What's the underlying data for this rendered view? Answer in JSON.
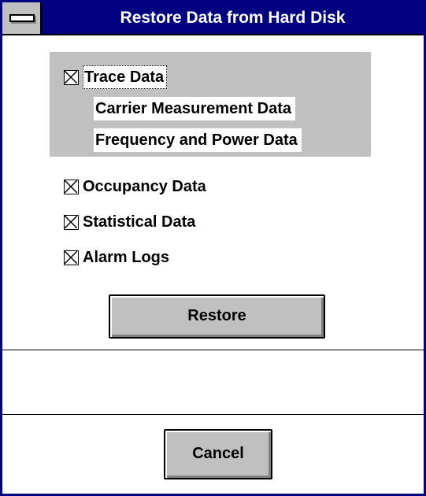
{
  "window": {
    "title": "Restore Data from Hard Disk"
  },
  "trace_group": {
    "trace": {
      "label": "Trace Data",
      "checked": true
    },
    "sub_items": [
      {
        "label": "Carrier Measurement Data"
      },
      {
        "label": "Frequency and Power Data"
      }
    ]
  },
  "options": [
    {
      "label": "Occupancy Data",
      "checked": true
    },
    {
      "label": "Statistical Data",
      "checked": true
    },
    {
      "label": "Alarm Logs",
      "checked": true
    }
  ],
  "buttons": {
    "restore": "Restore",
    "cancel": "Cancel"
  },
  "colors": {
    "title_bar": "#000080",
    "face": "#c0c0c0",
    "background": "#ffffff"
  },
  "icons": {
    "system_menu": "system-menu-icon",
    "checkbox": "checkbox-checked-icon"
  }
}
